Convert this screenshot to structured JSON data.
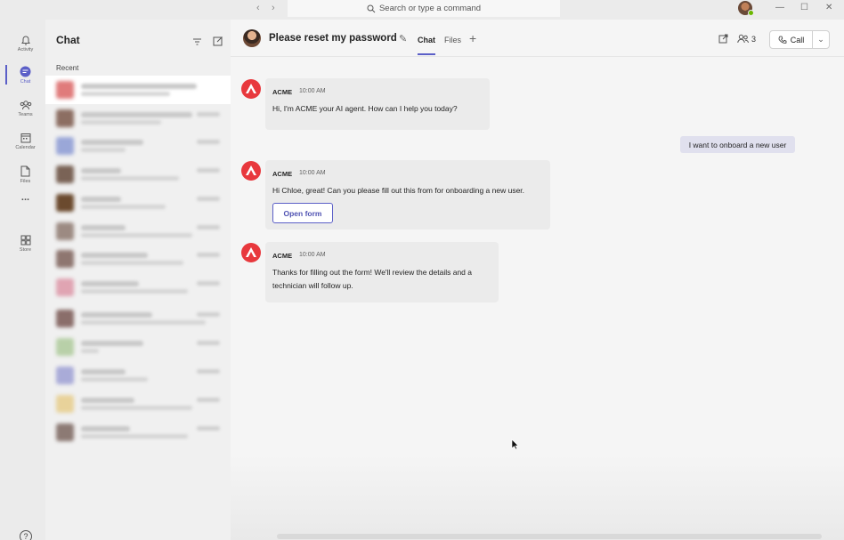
{
  "titlebar": {
    "search_placeholder": "Search or type a command",
    "minimize": "—",
    "maximize": "☐",
    "close": "✕"
  },
  "rail": {
    "items": [
      {
        "label": "Activity",
        "icon": "bell-icon"
      },
      {
        "label": "Chat",
        "icon": "chat-icon"
      },
      {
        "label": "Teams",
        "icon": "teams-icon"
      },
      {
        "label": "Calendar",
        "icon": "calendar-icon"
      },
      {
        "label": "Files",
        "icon": "file-icon"
      },
      {
        "label": "...",
        "icon": "more-icon"
      },
      {
        "label": "Store",
        "icon": "apps-icon"
      }
    ],
    "help": "?"
  },
  "chat_list": {
    "title": "Chat",
    "section": "Recent"
  },
  "conversation": {
    "title": "Please reset my password",
    "tabs": [
      "Chat",
      "Files"
    ],
    "participants_count": "3",
    "call_label": "Call"
  },
  "messages": [
    {
      "sender": "ACME",
      "time": "10:00 AM",
      "lines": [
        "Hi, I'm ACME your AI agent. How can I help you today?"
      ]
    },
    {
      "sender": "ACME",
      "time": "10:00 AM",
      "lines": [
        "Hi Chloe, great! Can you please fill out this from for onboarding a new user."
      ],
      "button": "Open form"
    },
    {
      "sender": "ACME",
      "time": "10:00 AM",
      "lines": [
        "Thanks for filling out the form! We'll review the details and a",
        "technician will follow up."
      ]
    }
  ],
  "my_message": "I want to onboard a new user",
  "colors": {
    "accent": "#5b5fc7",
    "acme_red": "#e8383d"
  }
}
